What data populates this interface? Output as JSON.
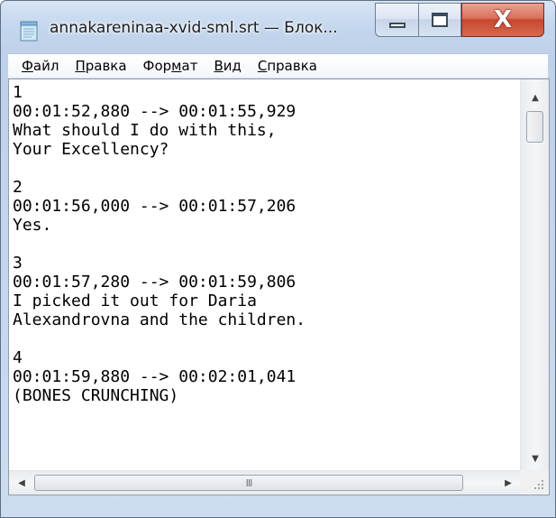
{
  "window": {
    "title": "annakareninaa-xvid-sml.srt — Блок...",
    "icon": "notepad-icon",
    "controls": {
      "minimize_icon": "minimize-icon",
      "maximize_icon": "maximize-icon",
      "close_label": "X"
    }
  },
  "menu": {
    "items": [
      {
        "accel": "Ф",
        "rest": "айл"
      },
      {
        "accel": "П",
        "rest": "равка"
      },
      {
        "pre": "Фор",
        "accel": "м",
        "rest": "ат"
      },
      {
        "accel": "В",
        "rest": "ид"
      },
      {
        "accel": "С",
        "rest": "правка"
      }
    ]
  },
  "editor": {
    "lines": [
      "1",
      "00:01:52,880 --> 00:01:55,929",
      "What should I do with this,",
      "Your Excellency?",
      "",
      "2",
      "00:01:56,000 --> 00:01:57,206",
      "Yes.",
      "",
      "3",
      "00:01:57,280 --> 00:01:59,806",
      "I picked it out for Daria",
      "Alexandrovna and the children.",
      "",
      "4",
      "00:01:59,880 --> 00:02:01,041",
      "(BONES CRUNCHING)"
    ]
  },
  "scrollbars": {
    "vertical_position": 0.0,
    "horizontal_grip": "III"
  },
  "colors": {
    "close_button": "#c7472f",
    "frame": "#c4d6ed"
  }
}
